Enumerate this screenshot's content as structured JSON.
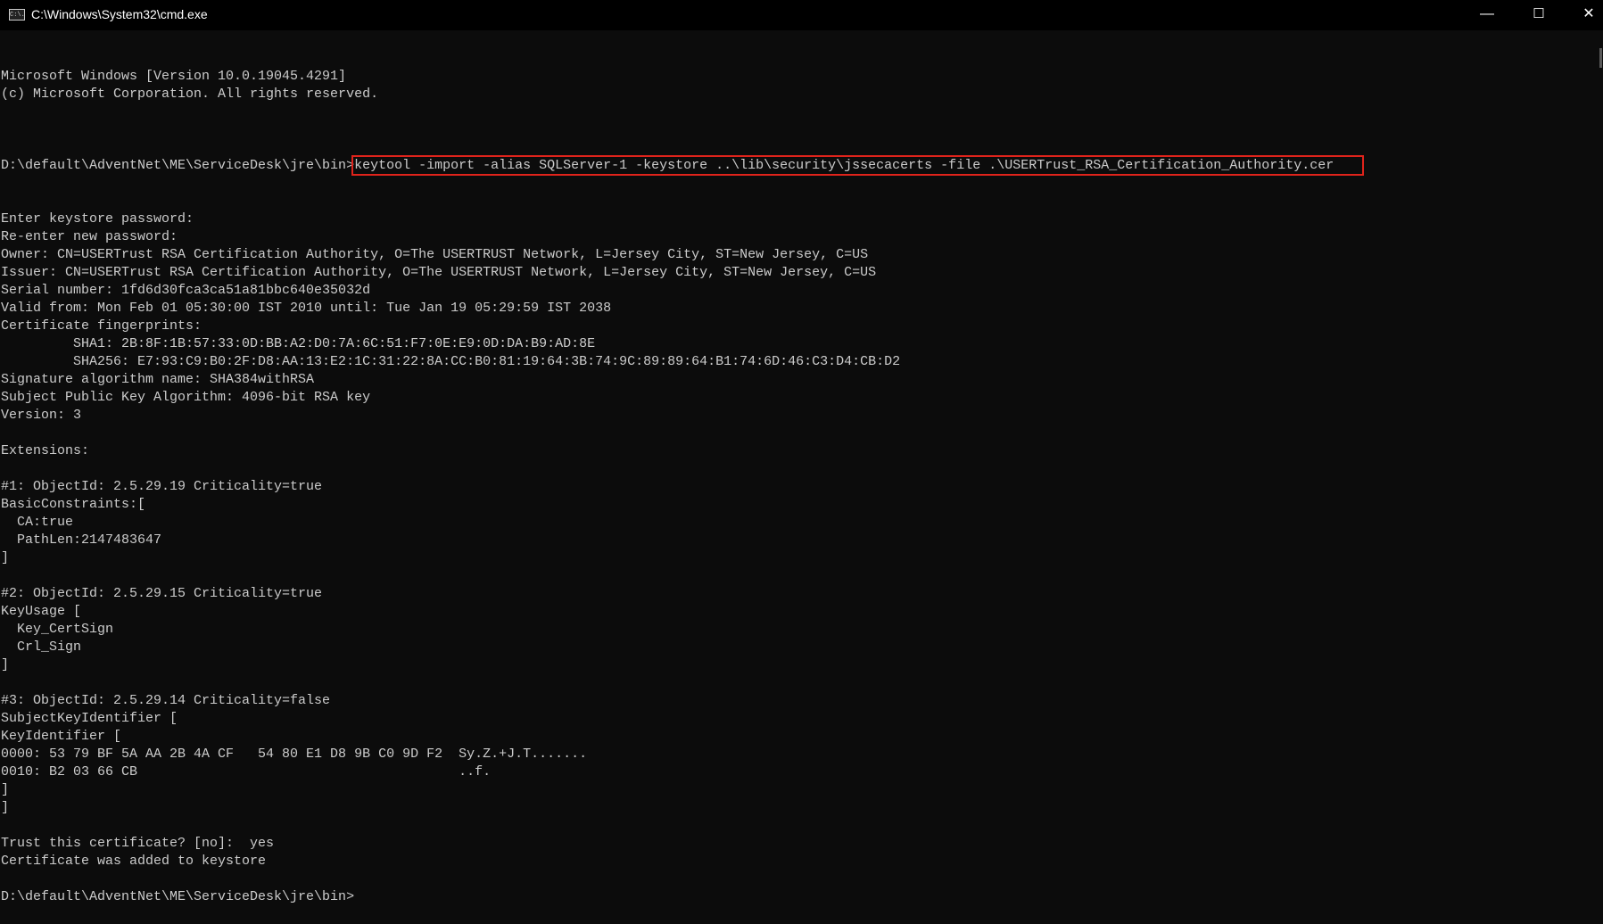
{
  "window": {
    "title": "C:\\Windows\\System32\\cmd.exe",
    "icon_text": "C:\\.",
    "minimize_icon": "—",
    "maximize_icon": "☐",
    "close_icon": "✕"
  },
  "console": {
    "prompt": "D:\\default\\AdventNet\\ME\\ServiceDesk\\jre\\bin>",
    "command": "keytool -import -alias SQLServer-1 -keystore ..\\lib\\security\\jssecacerts -file .\\USERTrust_RSA_Certification_Authority.cer",
    "highlight_color": "#e0231b",
    "lines_before": [
      "Microsoft Windows [Version 10.0.19045.4291]",
      "(c) Microsoft Corporation. All rights reserved.",
      ""
    ],
    "lines_after": [
      "Enter keystore password:",
      "Re-enter new password:",
      "Owner: CN=USERTrust RSA Certification Authority, O=The USERTRUST Network, L=Jersey City, ST=New Jersey, C=US",
      "Issuer: CN=USERTrust RSA Certification Authority, O=The USERTRUST Network, L=Jersey City, ST=New Jersey, C=US",
      "Serial number: 1fd6d30fca3ca51a81bbc640e35032d",
      "Valid from: Mon Feb 01 05:30:00 IST 2010 until: Tue Jan 19 05:29:59 IST 2038",
      "Certificate fingerprints:",
      "         SHA1: 2B:8F:1B:57:33:0D:BB:A2:D0:7A:6C:51:F7:0E:E9:0D:DA:B9:AD:8E",
      "         SHA256: E7:93:C9:B0:2F:D8:AA:13:E2:1C:31:22:8A:CC:B0:81:19:64:3B:74:9C:89:89:64:B1:74:6D:46:C3:D4:CB:D2",
      "Signature algorithm name: SHA384withRSA",
      "Subject Public Key Algorithm: 4096-bit RSA key",
      "Version: 3",
      "",
      "Extensions:",
      "",
      "#1: ObjectId: 2.5.29.19 Criticality=true",
      "BasicConstraints:[",
      "  CA:true",
      "  PathLen:2147483647",
      "]",
      "",
      "#2: ObjectId: 2.5.29.15 Criticality=true",
      "KeyUsage [",
      "  Key_CertSign",
      "  Crl_Sign",
      "]",
      "",
      "#3: ObjectId: 2.5.29.14 Criticality=false",
      "SubjectKeyIdentifier [",
      "KeyIdentifier [",
      "0000: 53 79 BF 5A AA 2B 4A CF   54 80 E1 D8 9B C0 9D F2  Sy.Z.+J.T.......",
      "0010: B2 03 66 CB                                        ..f.",
      "]",
      "]",
      "",
      "Trust this certificate? [no]:  yes",
      "Certificate was added to keystore",
      "",
      "D:\\default\\AdventNet\\ME\\ServiceDesk\\jre\\bin>"
    ]
  }
}
